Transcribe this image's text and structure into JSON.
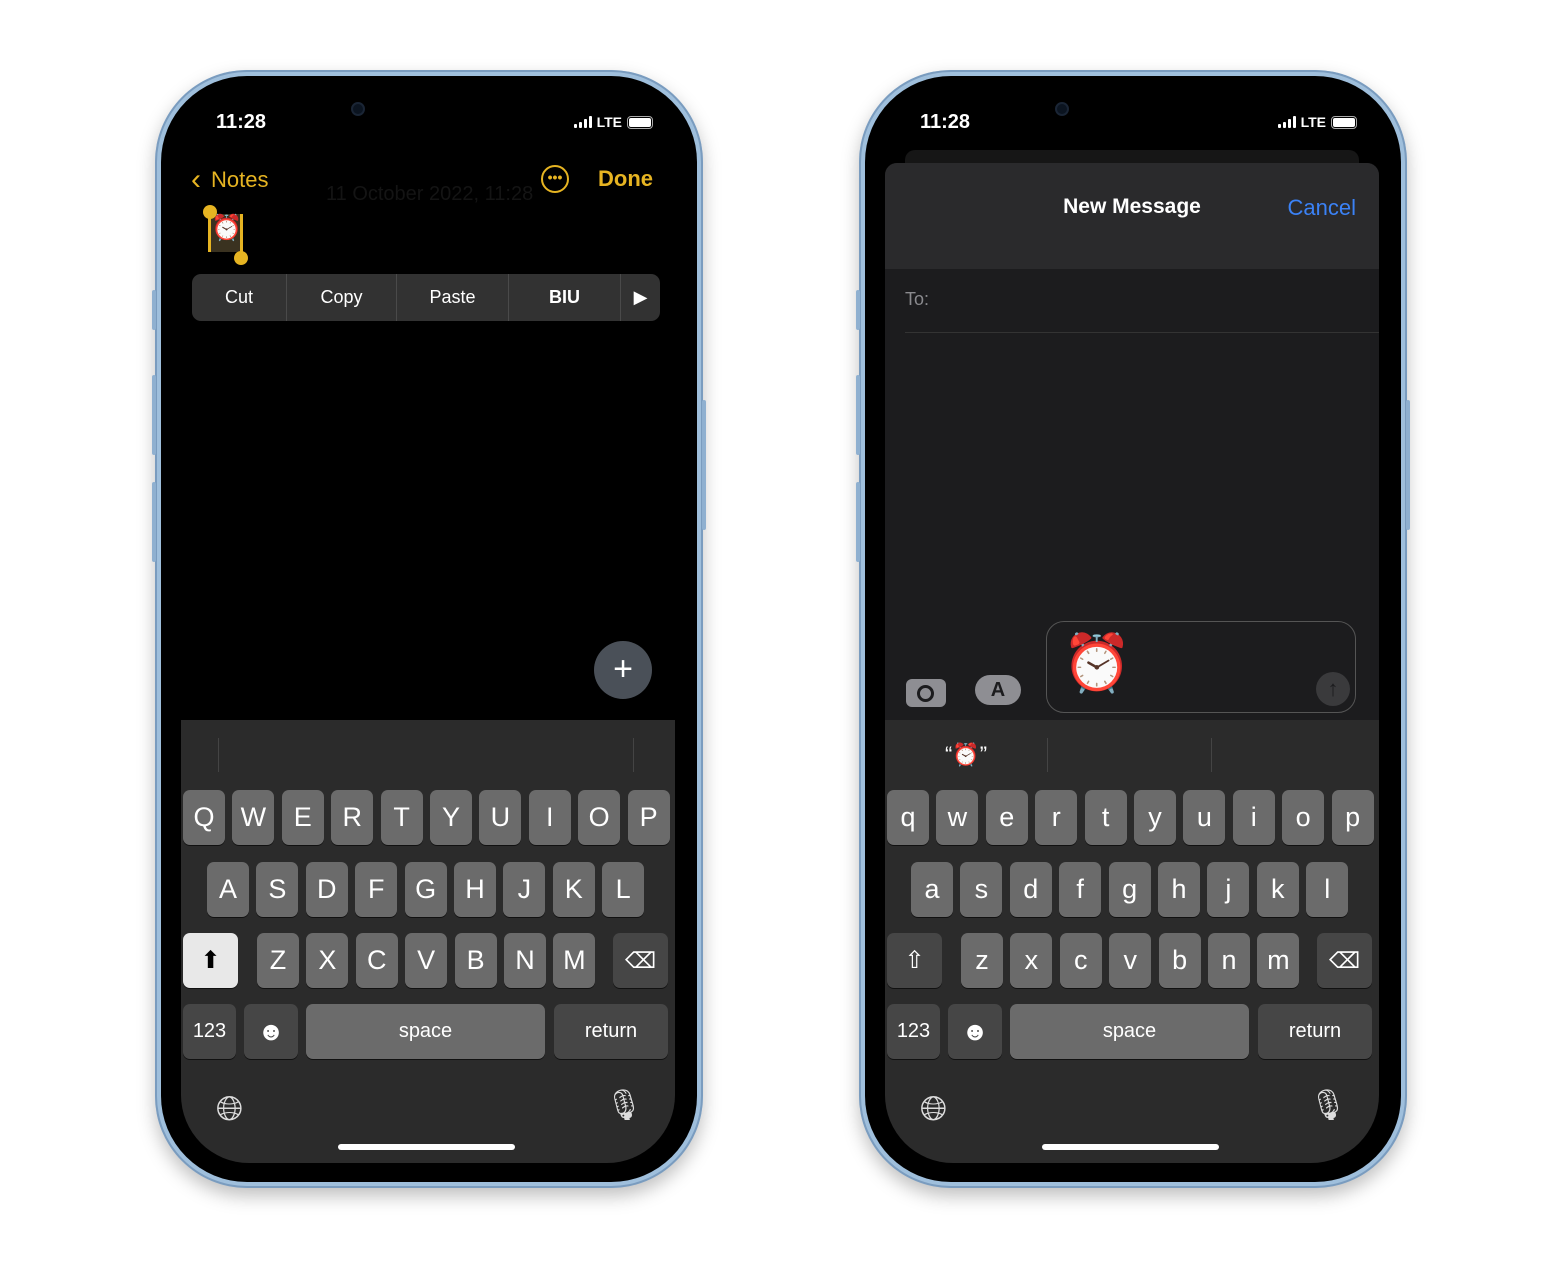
{
  "phones": [
    {
      "status": {
        "time": "11:28",
        "network": "LTE"
      },
      "notes": {
        "back_label": "Notes",
        "done_label": "Done",
        "date_text": "11 October 2022, 11:28",
        "selected_emoji": "⏰",
        "menu": [
          "Cut",
          "Copy",
          "Paste",
          "BIU",
          "▶"
        ],
        "accent": "#e6b422"
      },
      "keyboard": {
        "rows": [
          [
            "Q",
            "W",
            "E",
            "R",
            "T",
            "Y",
            "U",
            "I",
            "O",
            "P"
          ],
          [
            "A",
            "S",
            "D",
            "F",
            "G",
            "H",
            "J",
            "K",
            "L"
          ],
          [
            "Z",
            "X",
            "C",
            "V",
            "B",
            "N",
            "M"
          ]
        ],
        "shift_active": true,
        "numbers": "123",
        "space": "space",
        "return": "return",
        "suggestions": [
          "",
          "",
          ""
        ]
      }
    },
    {
      "status": {
        "time": "11:28",
        "network": "LTE"
      },
      "message": {
        "title": "New Message",
        "cancel_label": "Cancel",
        "to_label": "To:",
        "body_emoji": "⏰",
        "accent": "#3b82f6"
      },
      "keyboard": {
        "rows": [
          [
            "q",
            "w",
            "e",
            "r",
            "t",
            "y",
            "u",
            "i",
            "o",
            "p"
          ],
          [
            "a",
            "s",
            "d",
            "f",
            "g",
            "h",
            "j",
            "k",
            "l"
          ],
          [
            "z",
            "x",
            "c",
            "v",
            "b",
            "n",
            "m"
          ]
        ],
        "shift_active": false,
        "numbers": "123",
        "space": "space",
        "return": "return",
        "suggestions": [
          "“⏰”",
          "",
          ""
        ]
      }
    }
  ]
}
